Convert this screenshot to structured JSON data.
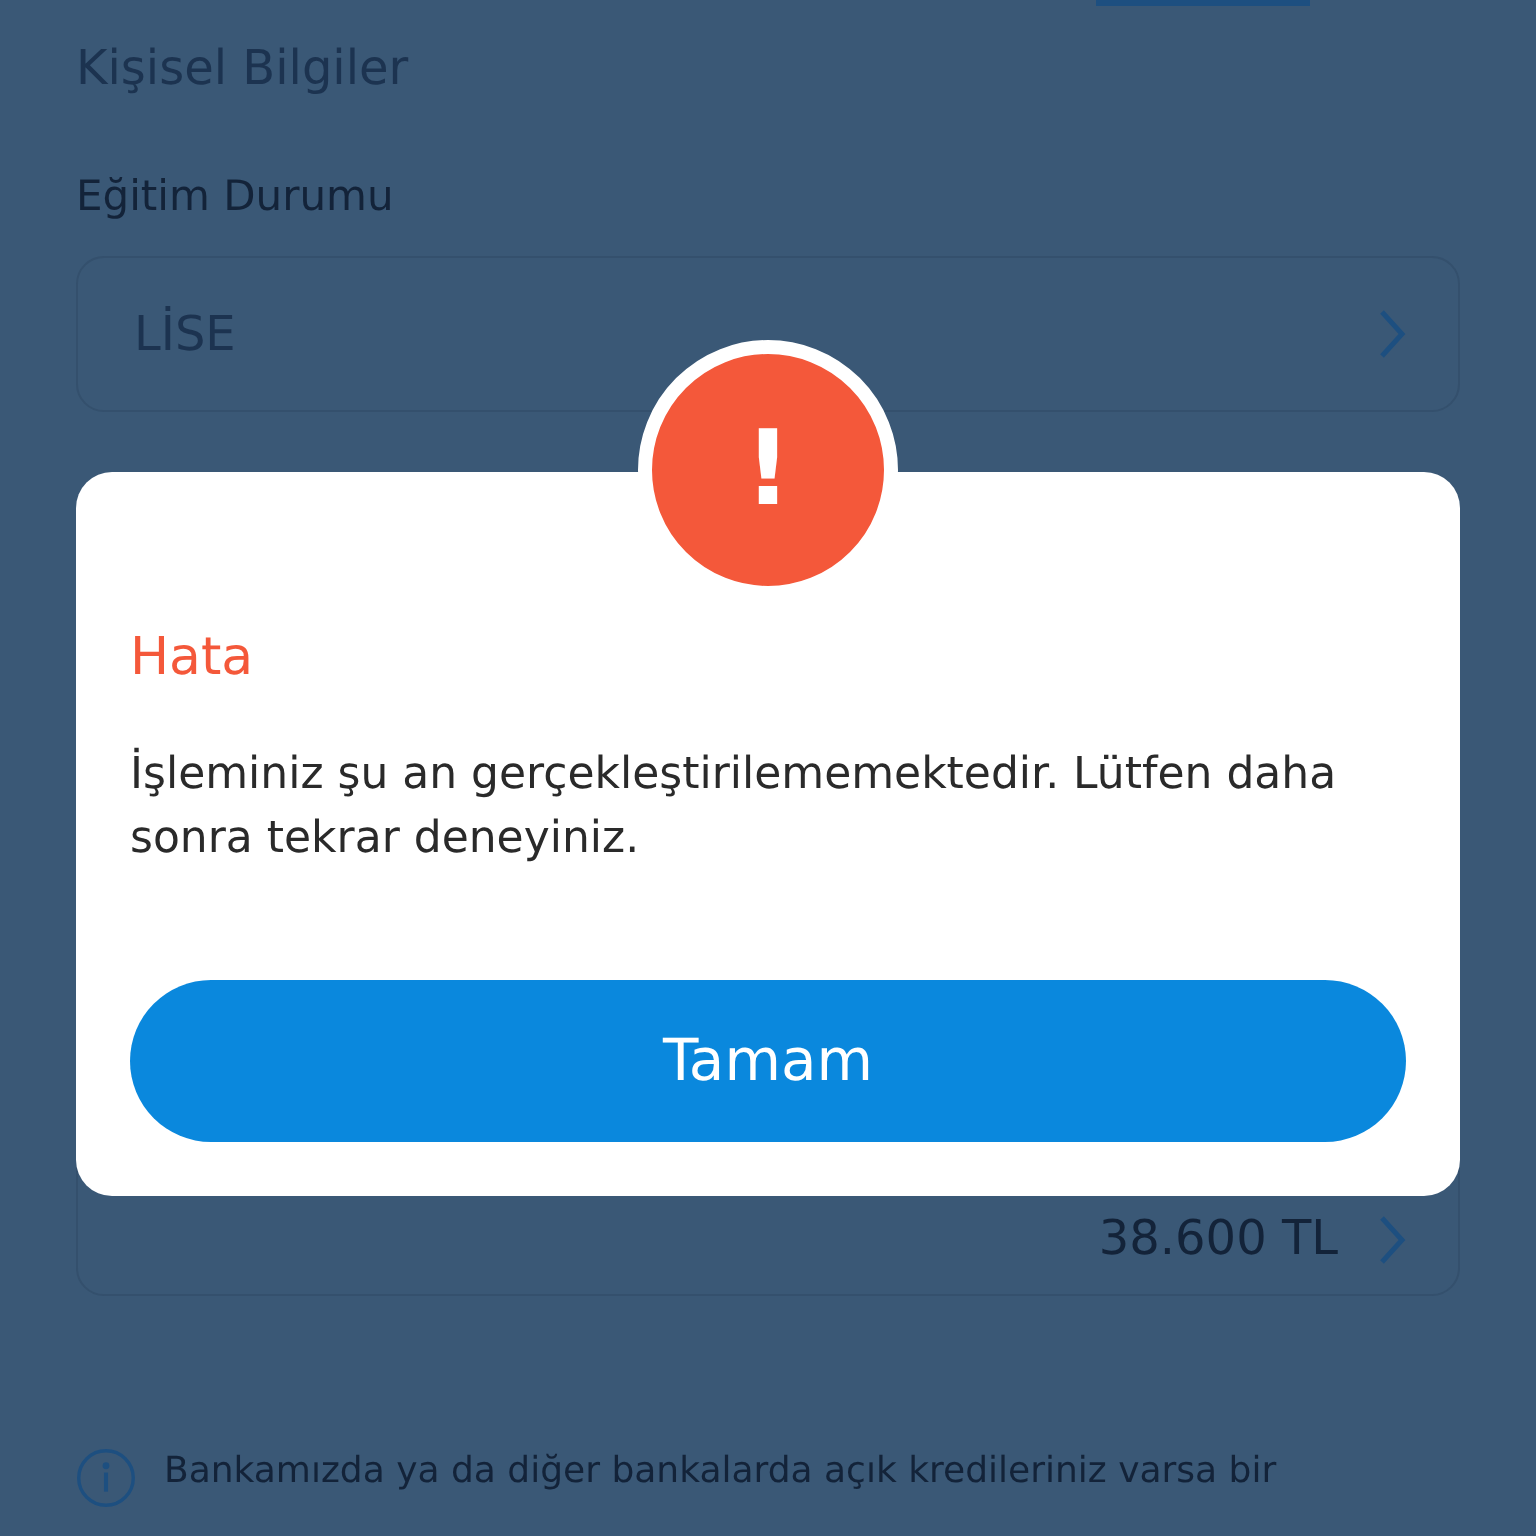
{
  "page": {
    "section_title": "Kişisel Bilgiler",
    "education_label": "Eğitim Durumu",
    "education_value": "LİSE",
    "amount_value": "38.600 TL",
    "info_text": "Bankamızda ya da diğer bankalarda açık kredileriniz varsa bir"
  },
  "dialog": {
    "icon": "!",
    "title": "Hata",
    "message": "İşleminiz şu an gerçekleştirilememektedir. Lütfen daha sonra tekrar deneyiniz.",
    "button": "Tamam"
  }
}
